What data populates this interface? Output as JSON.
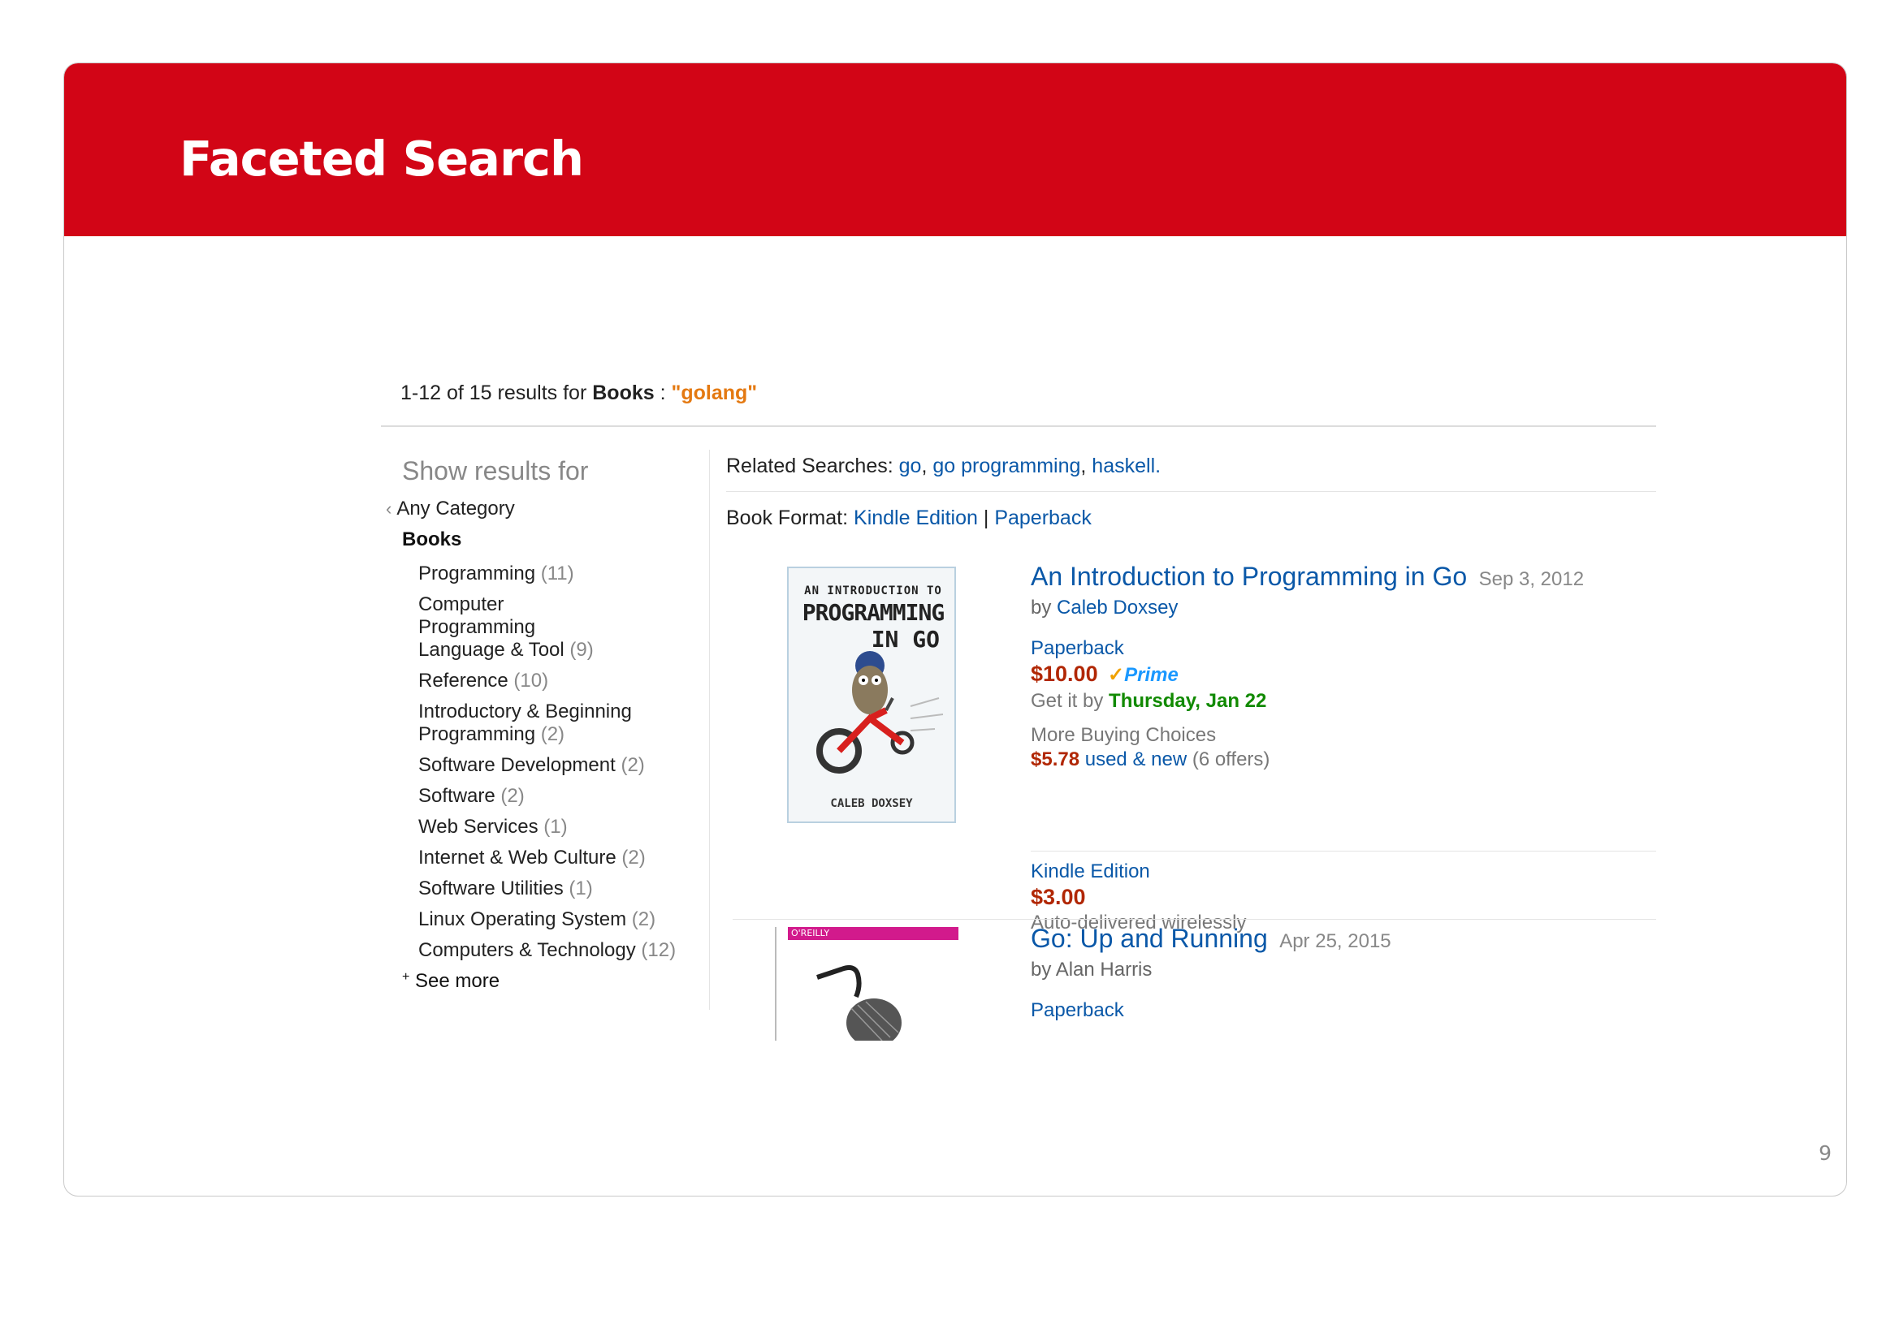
{
  "slide": {
    "title": "Faceted Search",
    "page_number": "9"
  },
  "results": {
    "range": "1-12 of 15 results for",
    "category": "Books",
    "colon": ":",
    "query": "\"golang\""
  },
  "sidebar": {
    "title": "Show results for",
    "any_category": "Any Category",
    "current": "Books",
    "items": [
      {
        "label": "Programming",
        "count": "(11)"
      },
      {
        "label": "Computer Programming Language & Tool",
        "count": "(9)"
      },
      {
        "label": "Reference",
        "count": "(10)"
      },
      {
        "label": "Introductory & Beginning Programming",
        "count": "(2)"
      },
      {
        "label": "Software Development",
        "count": "(2)"
      },
      {
        "label": "Software",
        "count": "(2)"
      },
      {
        "label": "Web Services",
        "count": "(1)"
      },
      {
        "label": "Internet & Web Culture",
        "count": "(2)"
      },
      {
        "label": "Software Utilities",
        "count": "(1)"
      },
      {
        "label": "Linux Operating System",
        "count": "(2)"
      },
      {
        "label": "Computers & Technology",
        "count": "(12)"
      }
    ],
    "see_more": "See more"
  },
  "related": {
    "label": "Related Searches:",
    "links": [
      "go",
      "go programming",
      "haskell."
    ]
  },
  "format": {
    "label": "Book Format:",
    "options": [
      "Kindle Edition",
      "Paperback"
    ],
    "separator": "|"
  },
  "products": [
    {
      "title": "An Introduction to Programming in Go",
      "date": "Sep 3, 2012",
      "by": "by",
      "author": "Caleb Doxsey",
      "cover_text_1": "AN INTRODUCTION TO",
      "cover_text_2": "PROGRAMMING",
      "cover_text_3": "IN GO",
      "cover_author": "CALEB DOXSEY",
      "format1": "Paperback",
      "price1": "$10.00",
      "prime": "Prime",
      "delivery_prefix": "Get it by",
      "delivery_date": "Thursday, Jan 22",
      "more_choices": "More Buying Choices",
      "used_price": "$5.78",
      "used_label": "used & new",
      "offers": "(6 offers)",
      "format2": "Kindle Edition",
      "price2": "$3.00",
      "delivery2": "Auto-delivered wirelessly"
    },
    {
      "title": "Go: Up and Running",
      "date": "Apr 25, 2015",
      "by": "by Alan Harris",
      "cover_publisher": "O'REILLY",
      "format1": "Paperback"
    }
  ],
  "colors": {
    "banner": "#d20516",
    "link": "#0a58a8",
    "price": "#b12704",
    "query": "#e47911",
    "delivery": "#118a00"
  }
}
